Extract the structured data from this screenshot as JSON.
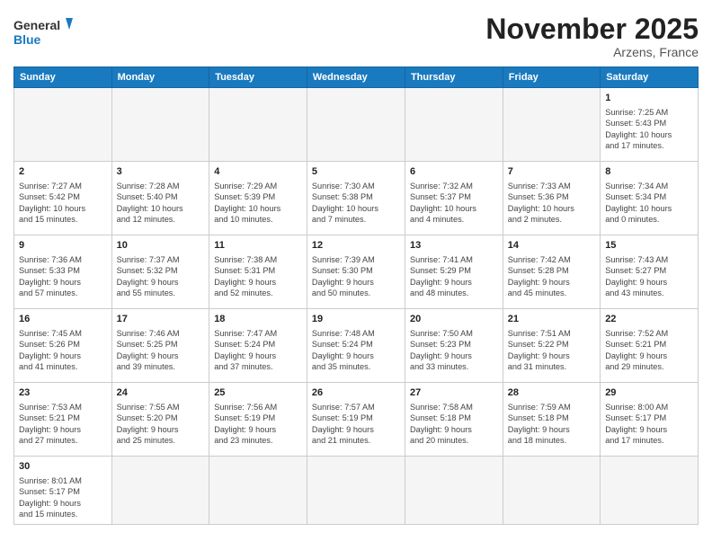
{
  "header": {
    "logo_general": "General",
    "logo_blue": "Blue",
    "month_title": "November 2025",
    "location": "Arzens, France"
  },
  "weekdays": [
    "Sunday",
    "Monday",
    "Tuesday",
    "Wednesday",
    "Thursday",
    "Friday",
    "Saturday"
  ],
  "days": [
    {
      "num": "",
      "info": ""
    },
    {
      "num": "",
      "info": ""
    },
    {
      "num": "",
      "info": ""
    },
    {
      "num": "",
      "info": ""
    },
    {
      "num": "",
      "info": ""
    },
    {
      "num": "",
      "info": ""
    },
    {
      "num": "1",
      "info": "Sunrise: 7:25 AM\nSunset: 5:43 PM\nDaylight: 10 hours\nand 17 minutes."
    },
    {
      "num": "2",
      "info": "Sunrise: 7:27 AM\nSunset: 5:42 PM\nDaylight: 10 hours\nand 15 minutes."
    },
    {
      "num": "3",
      "info": "Sunrise: 7:28 AM\nSunset: 5:40 PM\nDaylight: 10 hours\nand 12 minutes."
    },
    {
      "num": "4",
      "info": "Sunrise: 7:29 AM\nSunset: 5:39 PM\nDaylight: 10 hours\nand 10 minutes."
    },
    {
      "num": "5",
      "info": "Sunrise: 7:30 AM\nSunset: 5:38 PM\nDaylight: 10 hours\nand 7 minutes."
    },
    {
      "num": "6",
      "info": "Sunrise: 7:32 AM\nSunset: 5:37 PM\nDaylight: 10 hours\nand 4 minutes."
    },
    {
      "num": "7",
      "info": "Sunrise: 7:33 AM\nSunset: 5:36 PM\nDaylight: 10 hours\nand 2 minutes."
    },
    {
      "num": "8",
      "info": "Sunrise: 7:34 AM\nSunset: 5:34 PM\nDaylight: 10 hours\nand 0 minutes."
    },
    {
      "num": "9",
      "info": "Sunrise: 7:36 AM\nSunset: 5:33 PM\nDaylight: 9 hours\nand 57 minutes."
    },
    {
      "num": "10",
      "info": "Sunrise: 7:37 AM\nSunset: 5:32 PM\nDaylight: 9 hours\nand 55 minutes."
    },
    {
      "num": "11",
      "info": "Sunrise: 7:38 AM\nSunset: 5:31 PM\nDaylight: 9 hours\nand 52 minutes."
    },
    {
      "num": "12",
      "info": "Sunrise: 7:39 AM\nSunset: 5:30 PM\nDaylight: 9 hours\nand 50 minutes."
    },
    {
      "num": "13",
      "info": "Sunrise: 7:41 AM\nSunset: 5:29 PM\nDaylight: 9 hours\nand 48 minutes."
    },
    {
      "num": "14",
      "info": "Sunrise: 7:42 AM\nSunset: 5:28 PM\nDaylight: 9 hours\nand 45 minutes."
    },
    {
      "num": "15",
      "info": "Sunrise: 7:43 AM\nSunset: 5:27 PM\nDaylight: 9 hours\nand 43 minutes."
    },
    {
      "num": "16",
      "info": "Sunrise: 7:45 AM\nSunset: 5:26 PM\nDaylight: 9 hours\nand 41 minutes."
    },
    {
      "num": "17",
      "info": "Sunrise: 7:46 AM\nSunset: 5:25 PM\nDaylight: 9 hours\nand 39 minutes."
    },
    {
      "num": "18",
      "info": "Sunrise: 7:47 AM\nSunset: 5:24 PM\nDaylight: 9 hours\nand 37 minutes."
    },
    {
      "num": "19",
      "info": "Sunrise: 7:48 AM\nSunset: 5:24 PM\nDaylight: 9 hours\nand 35 minutes."
    },
    {
      "num": "20",
      "info": "Sunrise: 7:50 AM\nSunset: 5:23 PM\nDaylight: 9 hours\nand 33 minutes."
    },
    {
      "num": "21",
      "info": "Sunrise: 7:51 AM\nSunset: 5:22 PM\nDaylight: 9 hours\nand 31 minutes."
    },
    {
      "num": "22",
      "info": "Sunrise: 7:52 AM\nSunset: 5:21 PM\nDaylight: 9 hours\nand 29 minutes."
    },
    {
      "num": "23",
      "info": "Sunrise: 7:53 AM\nSunset: 5:21 PM\nDaylight: 9 hours\nand 27 minutes."
    },
    {
      "num": "24",
      "info": "Sunrise: 7:55 AM\nSunset: 5:20 PM\nDaylight: 9 hours\nand 25 minutes."
    },
    {
      "num": "25",
      "info": "Sunrise: 7:56 AM\nSunset: 5:19 PM\nDaylight: 9 hours\nand 23 minutes."
    },
    {
      "num": "26",
      "info": "Sunrise: 7:57 AM\nSunset: 5:19 PM\nDaylight: 9 hours\nand 21 minutes."
    },
    {
      "num": "27",
      "info": "Sunrise: 7:58 AM\nSunset: 5:18 PM\nDaylight: 9 hours\nand 20 minutes."
    },
    {
      "num": "28",
      "info": "Sunrise: 7:59 AM\nSunset: 5:18 PM\nDaylight: 9 hours\nand 18 minutes."
    },
    {
      "num": "29",
      "info": "Sunrise: 8:00 AM\nSunset: 5:17 PM\nDaylight: 9 hours\nand 17 minutes."
    },
    {
      "num": "30",
      "info": "Sunrise: 8:01 AM\nSunset: 5:17 PM\nDaylight: 9 hours\nand 15 minutes."
    },
    {
      "num": "",
      "info": ""
    },
    {
      "num": "",
      "info": ""
    },
    {
      "num": "",
      "info": ""
    },
    {
      "num": "",
      "info": ""
    },
    {
      "num": "",
      "info": ""
    },
    {
      "num": "",
      "info": ""
    }
  ]
}
